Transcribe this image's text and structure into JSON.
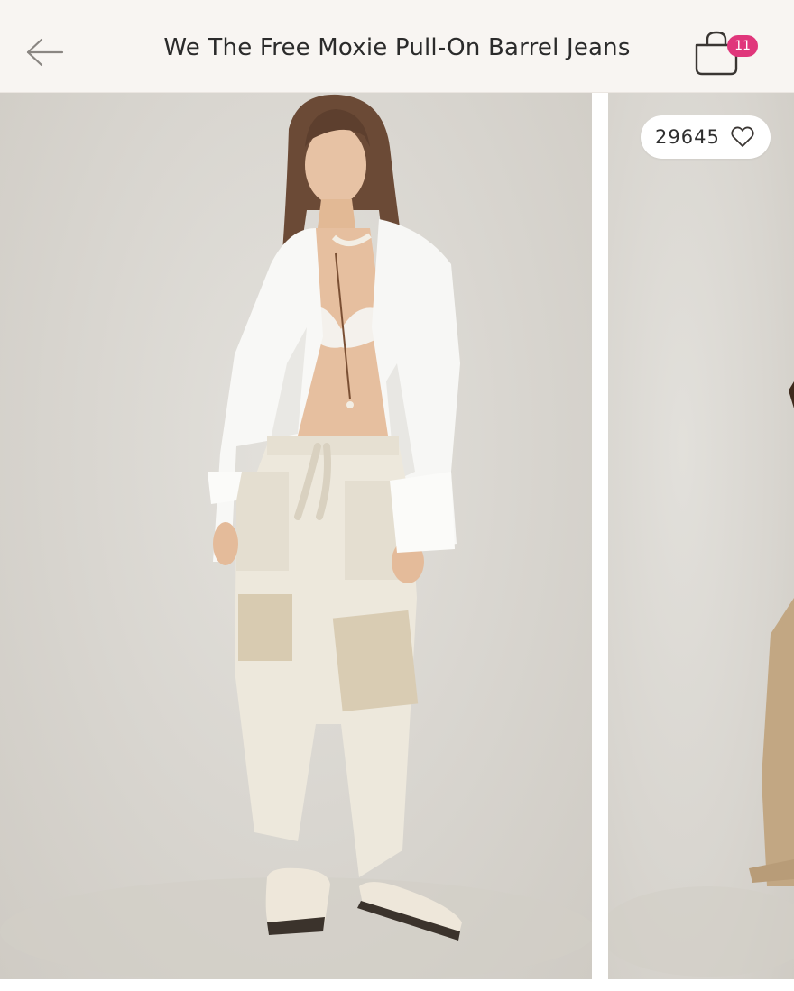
{
  "header": {
    "title": "We The Free Moxie Pull-On Barrel Jeans",
    "back_icon": "arrow-left-icon",
    "bag_icon": "shopping-bag-icon",
    "bag_count": "11"
  },
  "gallery": {
    "main_image": "product-photo-model-white-shirt-cream-barrel-jeans",
    "next_image": "product-photo-partial-khaki-jeans",
    "likes": "29645",
    "like_icon": "heart-outline-icon"
  },
  "colors": {
    "header_bg": "#f8f5f2",
    "badge": "#e0367b",
    "photo_bg": "#d8d5cf"
  }
}
